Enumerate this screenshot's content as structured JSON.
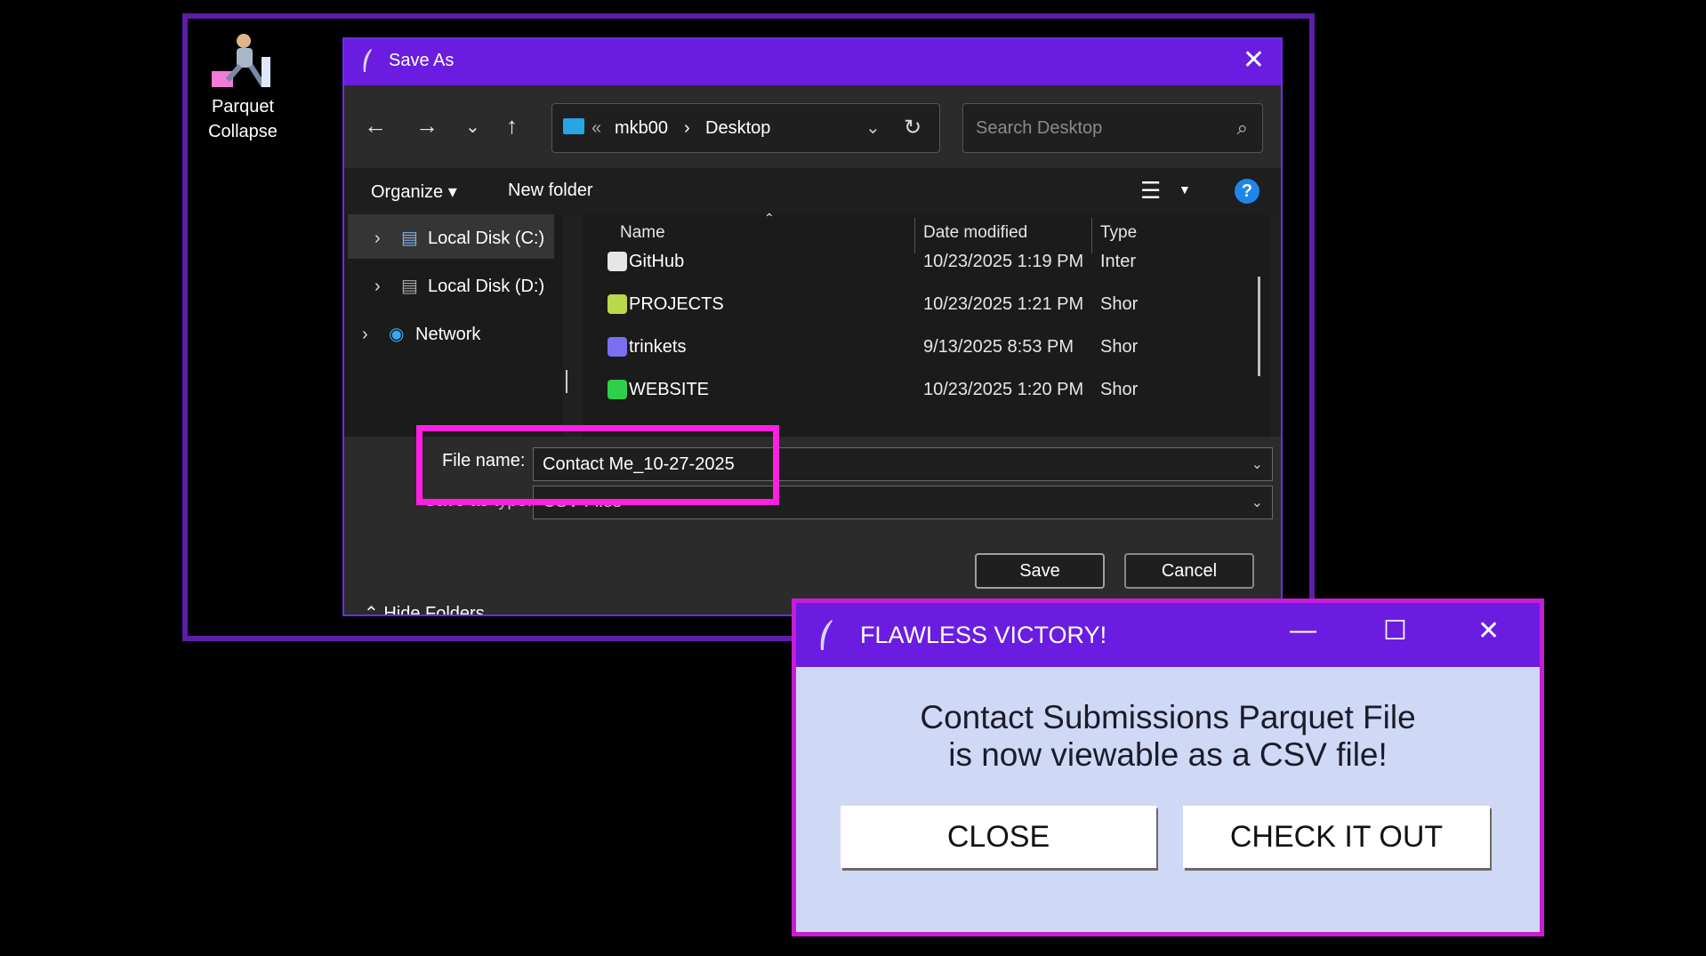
{
  "desktop": {
    "icon_label_line1": "Parquet",
    "icon_label_line2": "Collapse"
  },
  "save_dialog": {
    "title": "Save As",
    "close_glyph": "✕",
    "address": {
      "sep": "«",
      "crumb1": "mkb00",
      "arrow": "›",
      "crumb2": "Desktop"
    },
    "search_placeholder": "Search Desktop",
    "commands": {
      "organize": "Organize ▾",
      "new_folder": "New folder",
      "help": "?"
    },
    "tree": [
      {
        "label": "Local Disk (C:)"
      },
      {
        "label": "Local Disk (D:)"
      },
      {
        "label": "Network"
      }
    ],
    "columns": {
      "name": "Name",
      "date": "Date modified",
      "type": "Type"
    },
    "files": [
      {
        "name": "GitHub",
        "date": "10/23/2025 1:19 PM",
        "type": "Inter",
        "icon": "github-shortcut-icon"
      },
      {
        "name": "PROJECTS",
        "date": "10/23/2025 1:21 PM",
        "type": "Shor",
        "icon": "shortcut-icon"
      },
      {
        "name": "trinkets",
        "date": "9/13/2025 8:53 PM",
        "type": "Shor",
        "icon": "shortcut-icon"
      },
      {
        "name": "WEBSITE",
        "date": "10/23/2025 1:20 PM",
        "type": "Shor",
        "icon": "shortcut-icon"
      }
    ],
    "file_name_label": "File name:",
    "file_name_value": "Contact Me_10-27-2025",
    "save_type_label": "Save as type:",
    "save_type_value": "CSV Files",
    "save": "Save",
    "cancel": "Cancel",
    "hide_folders": "Hide Folders"
  },
  "victory_dialog": {
    "title": "FLAWLESS VICTORY!",
    "message_line1": "Contact Submissions Parquet File",
    "message_line2": "is now viewable as a CSV file!",
    "close_button": "CLOSE",
    "check_button": "CHECK IT OUT"
  },
  "colors": {
    "titlebar": "#6a1de0",
    "highlight": "#ff1fe0",
    "victory_bg": "#cfd8f5"
  }
}
